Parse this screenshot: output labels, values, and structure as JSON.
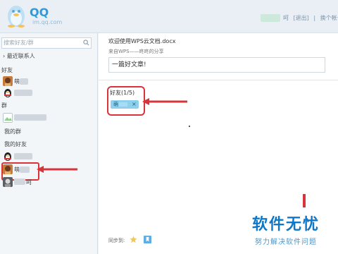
{
  "header": {
    "logo_text": "QQ",
    "logo_sub": "im.qq.com",
    "user_suffix": "呵",
    "logout_label": "[退出]",
    "switch_account_label": "换个帐号"
  },
  "sidebar": {
    "search_placeholder": "搜索好友/群",
    "recent_label": "最近联系人",
    "friends_label": "好友",
    "friend1_name": "萌",
    "groups_label": "群",
    "my_groups_label": "我的群",
    "my_friends_label": "我的好友",
    "friend_selected_name": "萌",
    "friend_last_suffix": "呵"
  },
  "main": {
    "doc_title": "欢迎使用WPS云文档.docx",
    "doc_source": "来自WPS——咚咚的分享",
    "message": "一篇好文章!",
    "friend_count": "好友(1/5)",
    "chip_name": "萌",
    "chip_close": "×",
    "sync_label": "同步到:"
  },
  "watermark": {
    "title": "软件无忧",
    "subtitle": "努力解决软件问题"
  },
  "colors": {
    "brand_blue": "#2f9bd9",
    "highlight_red": "#d9343a",
    "chip_blue": "#8dd0ee"
  }
}
